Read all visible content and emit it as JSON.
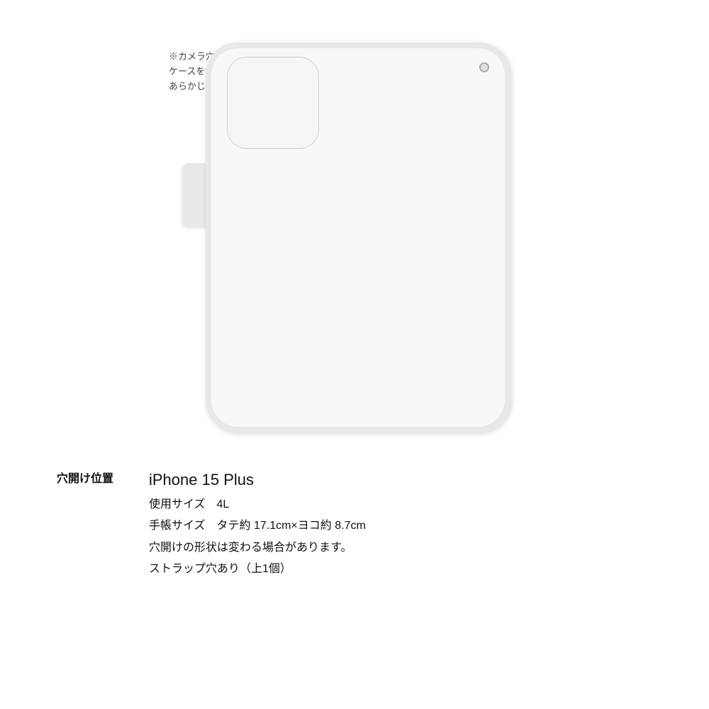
{
  "page": {
    "background_color": "#ffffff"
  },
  "note": {
    "text": "※カメラ穴の横ならびに上部は\nケースを接着しておりません。\nあらかじめご了承ください。"
  },
  "case": {
    "color": "#e8e8e8",
    "inner_color": "#f5f5f5"
  },
  "info": {
    "label": "穴開け位置",
    "device_name": "iPhone 15 Plus",
    "size_label": "使用サイズ　4L",
    "dimensions_label": "手帳サイズ　タテ約 17.1cm×ヨコ約 8.7cm",
    "shape_note": "穴開けの形状は変わる場合があります。",
    "strap_note": "ストラップ穴あり（上1個）"
  }
}
